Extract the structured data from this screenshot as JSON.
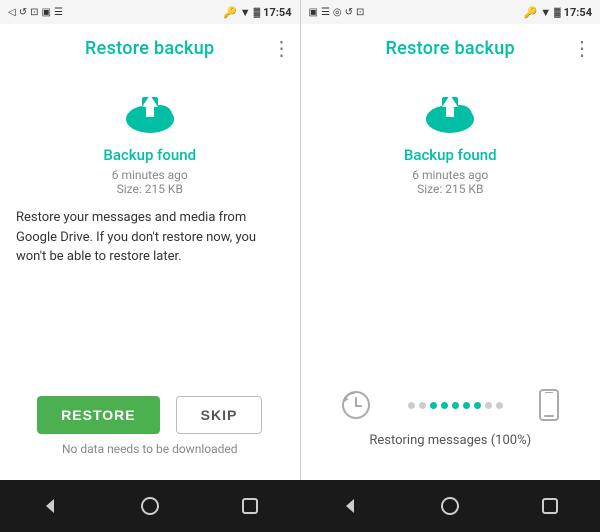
{
  "screens": [
    {
      "id": "screen-left",
      "statusBar": {
        "left": [
          "◁",
          "↺",
          "⊡",
          "▣",
          "☰"
        ],
        "time": "17:54",
        "right": [
          "🔑",
          "▼",
          "✕",
          "🔋"
        ]
      },
      "titleBar": {
        "title": "Restore backup",
        "menu": "⋮"
      },
      "cloud": {
        "ariaLabel": "cloud-upload-icon"
      },
      "backupFound": "Backup found",
      "backupTime": "6 minutes ago",
      "backupSize": "Size: 215 KB",
      "description": "Restore your messages and media from Google Drive. If you don't restore now, you won't be able to restore later.",
      "buttons": {
        "restore": "RESTORE",
        "skip": "SKIP"
      },
      "noData": "No data needs to be downloaded"
    },
    {
      "id": "screen-right",
      "statusBar": {
        "left": [
          "▣",
          "☰",
          "◎",
          "↺",
          "⊡"
        ],
        "time": "17:54",
        "right": [
          "🔑",
          "▼",
          "✕",
          "🔋"
        ]
      },
      "titleBar": {
        "title": "Restore backup",
        "menu": "⋮"
      },
      "cloud": {
        "ariaLabel": "cloud-upload-icon"
      },
      "backupFound": "Backup found",
      "backupTime": "6 minutes ago",
      "backupSize": "Size: 215 KB",
      "progress": {
        "dots": [
          {
            "active": false
          },
          {
            "active": false
          },
          {
            "active": true
          },
          {
            "active": true
          },
          {
            "active": true
          },
          {
            "active": true
          },
          {
            "active": true
          },
          {
            "active": false
          },
          {
            "active": false
          }
        ],
        "label": "Restoring messages (100%)"
      }
    }
  ],
  "navBar": {
    "back": "◁",
    "home": "○",
    "recent": "□"
  }
}
